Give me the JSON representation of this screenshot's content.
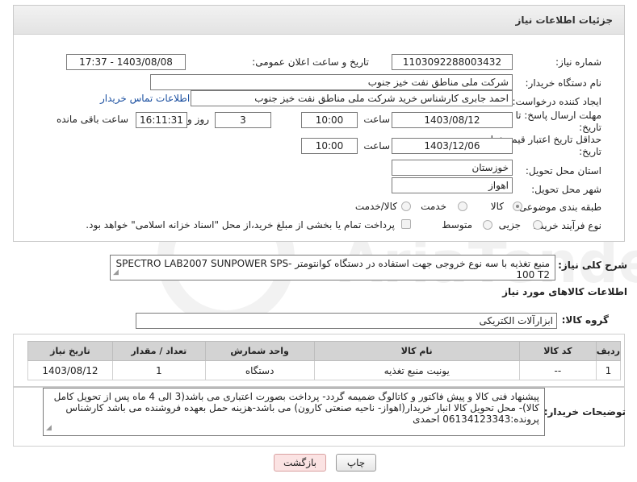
{
  "page": {
    "title": "جزئیات اطلاعات نیاز"
  },
  "form": {
    "need_number_label": "شماره نیاز:",
    "need_number": "1103092288003432",
    "announce_label": "تاریخ و ساعت اعلان عمومی:",
    "announce_value": "1403/08/08 - 17:37",
    "buyer_org_label": "نام دستگاه خریدار:",
    "buyer_org": "شرکت ملی مناطق نفت خیز جنوب",
    "requester_label": "ایجاد کننده درخواست:",
    "requester": "احمد جابری کارشناس خرید شرکت ملی مناطق نفت خیز جنوب",
    "contact_link": "اطلاعات تماس خریدار",
    "reply_deadline_label_1": "مهلت ارسال پاسخ: تا",
    "reply_deadline_label_2": "تاریخ:",
    "reply_date": "1403/08/12",
    "time_label": "ساعت",
    "reply_time": "10:00",
    "days_value": "3",
    "days_label": "روز و",
    "remaining_time": "16:11:31",
    "remaining_label": "ساعت باقی مانده",
    "price_validity_label_1": "حداقل تاریخ اعتبار قیمت: تا",
    "price_validity_label_2": "تاریخ:",
    "price_date": "1403/12/06",
    "price_time_label": "ساعت",
    "price_time": "10:00",
    "province_label": "استان محل تحویل:",
    "province": "خوزستان",
    "city_label": "شهر محل تحویل:",
    "city": "اهواز",
    "category_label": "طبقه بندی موضوعی:",
    "category_options": [
      "کالا",
      "خدمت",
      "کالا/خدمت"
    ],
    "process_label": "نوع فرآیند خرید :",
    "process_options": [
      "جزیی",
      "متوسط"
    ],
    "payment_note": "پرداخت تمام یا بخشی از مبلغ خرید،از محل \"اسناد خزانه اسلامی\" خواهد بود."
  },
  "summary": {
    "label": "شرح کلی نیاز:",
    "text": "منبع تغذیه با سه نوع خروجی جهت استفاده در دستگاه کوانتومتر -SPECTRO LAB2007 SUNPOWER SPS 100 T2"
  },
  "goods": {
    "section_title": "اطلاعات کالاهای مورد نیاز",
    "group_label": "گروه کالا:",
    "group_value": "ابزارآلات الکتریکی",
    "columns": [
      "ردیف",
      "کد کالا",
      "نام کالا",
      "واحد شمارش",
      "تعداد / مقدار",
      "تاریخ نیاز"
    ],
    "rows": [
      {
        "row": "1",
        "code": "--",
        "name": "یونیت منبع تغذیه",
        "unit": "دستگاه",
        "qty": "1",
        "date": "1403/08/12"
      }
    ]
  },
  "buyer_notes": {
    "label": "توضیحات خریدار:",
    "text": "پیشنهاد فنی کالا و پیش فاکتور و کاتالوگ ضمیمه گردد- پرداخت بصورت اعتباری می باشد(3 الی 4 ماه پس از تحویل کامل کالا)- محل تحویل کالا انبار خریدار(اهواز- ناحیه صنعتی کارون) می باشد-هزینه حمل بعهده فروشنده می باشد کارشناس پرونده:06134123343 احمدی"
  },
  "buttons": {
    "print": "چاپ",
    "back": "بازگشت"
  },
  "colors": {
    "link": "#1a4fa0",
    "header_bg": "#e8e8e8",
    "table_header": "#d3d3d3",
    "back_button": "#fbe3e3"
  }
}
